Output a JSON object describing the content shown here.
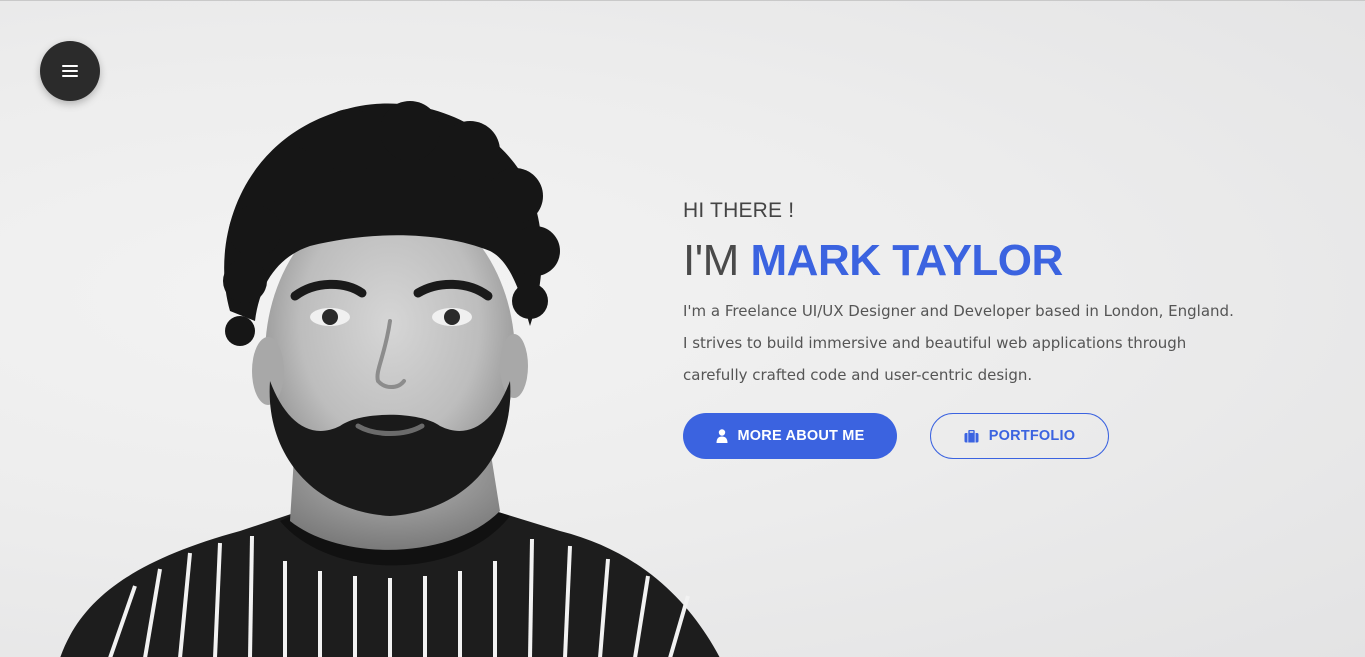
{
  "nav": {
    "menu_icon": "hamburger-menu-icon"
  },
  "hero": {
    "greeting": "HI THERE !",
    "headline_prefix": "I'M ",
    "name": "MARK TAYLOR",
    "bio_lines": [
      "I'm a Freelance UI/UX Designer and Developer based in London, England.",
      "I strives to build immersive and beautiful web applications through",
      "carefully crafted code and user-centric design."
    ],
    "primary_button": {
      "label": "MORE ABOUT ME",
      "icon": "user-icon"
    },
    "secondary_button": {
      "label": "PORTFOLIO",
      "icon": "briefcase-icon"
    }
  },
  "theme": {
    "accent": "#3b63e0",
    "menu_bg": "#2b2b2b",
    "text": "#4a4a4a"
  }
}
